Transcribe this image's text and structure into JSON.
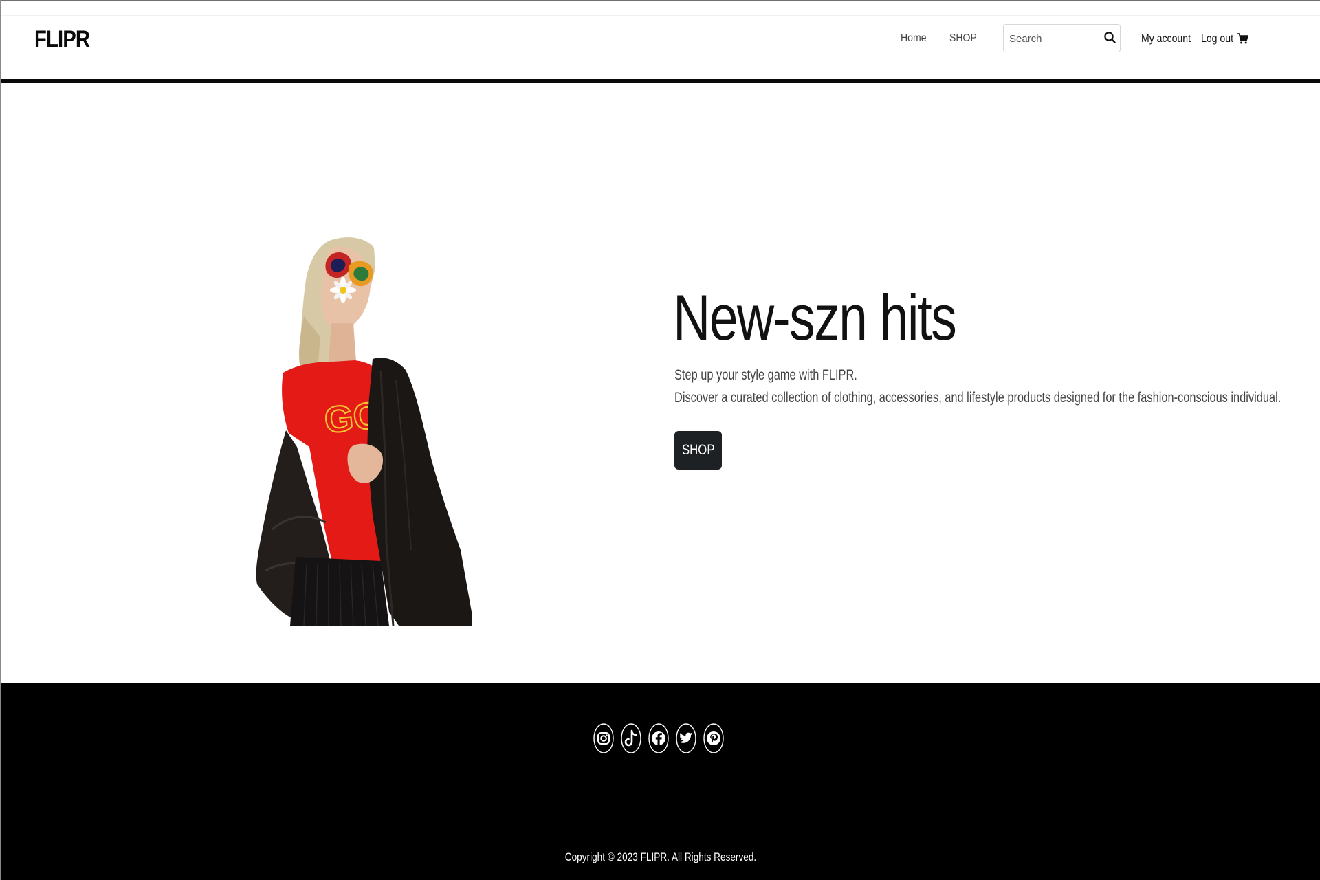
{
  "header": {
    "logo": "FLIPR",
    "nav": {
      "home": "Home",
      "shop": "SHOP"
    },
    "search": {
      "placeholder": "Search",
      "value": ""
    },
    "account": {
      "my_account": "My account",
      "log_out": "Log out"
    }
  },
  "hero": {
    "title": "New-szn hits",
    "line_1": "Step up your style game with FLIPR.",
    "line_2": "Discover a curated collection of clothing, accessories, and lifestyle products designed for the fashion-conscious individual.",
    "cta": "SHOP"
  },
  "footer": {
    "social_icons": [
      "instagram-icon",
      "tiktok-icon",
      "facebook-icon",
      "twitter-icon",
      "pinterest-icon"
    ],
    "copyright": "Copyright © 2023 FLIPR. All Rights Reserved."
  },
  "colors": {
    "background": "#ffffff",
    "footer_background": "#000000",
    "button_background": "#1e2124",
    "text_primary": "#111111"
  }
}
